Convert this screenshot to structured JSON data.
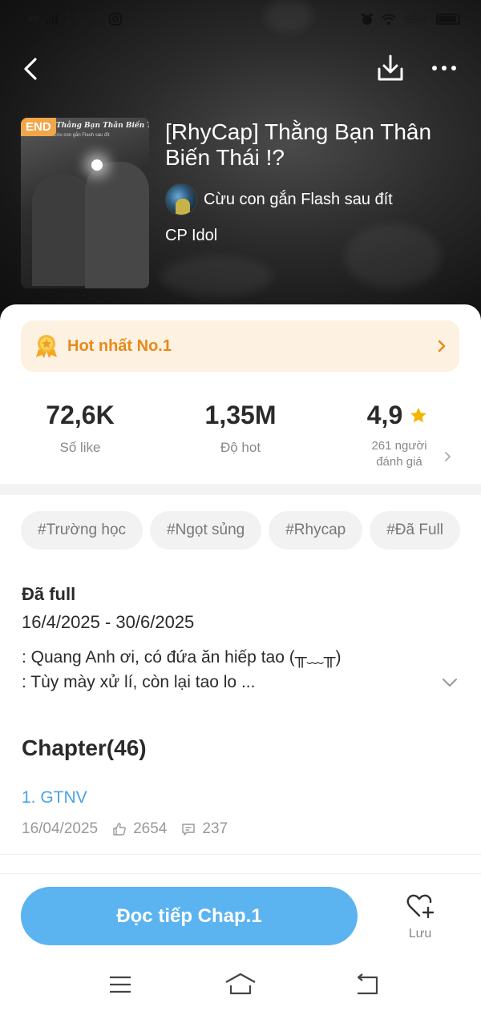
{
  "status_bar": {
    "network": "4G",
    "time": "19:39",
    "battery": "95%"
  },
  "story": {
    "cover_badge": "END",
    "cover_title_text": "Thằng Bạn Thân Biến Thái !?",
    "cover_sub_text": "Cừu con gắn Flash sau đít",
    "title": "[RhyCap] Thằng Bạn Thân Biến Thái !?",
    "author": "Cừu con gắn Flash sau đít",
    "category": "CP Idol"
  },
  "hot_banner": {
    "label": "Hot nhất No.1"
  },
  "stats": {
    "likes_value": "72,6K",
    "likes_label": "Số like",
    "hot_value": "1,35M",
    "hot_label": "Độ hot",
    "rating_value": "4,9",
    "rating_label_line1": "261 người",
    "rating_label_line2": "đánh giá"
  },
  "tags": [
    "#Trường học",
    "#Ngọt sủng",
    "#Rhycap",
    "#Đã Full"
  ],
  "info": {
    "status": "Đã full",
    "date_range": "16/4/2025 - 30/6/2025",
    "desc_line1": ": Quang Anh ơi, có đứa ăn hiếp tao (╥﹏╥)",
    "desc_line2": ": Tùy mày xử lí, còn lại tao lo ..."
  },
  "chapters": {
    "header": "Chapter(46)",
    "items": [
      {
        "title": "1. GTNV",
        "date": "16/04/2025",
        "likes": "2654",
        "comments": "237"
      }
    ]
  },
  "actions": {
    "read_label": "Đọc tiếp Chap.1",
    "save_label": "Lưu"
  },
  "colors": {
    "accent_blue": "#5bb3f0",
    "link_blue": "#4aa3e6",
    "hot_orange": "#e88a1a",
    "star_yellow": "#f5b400",
    "end_badge": "#f2a64a"
  }
}
